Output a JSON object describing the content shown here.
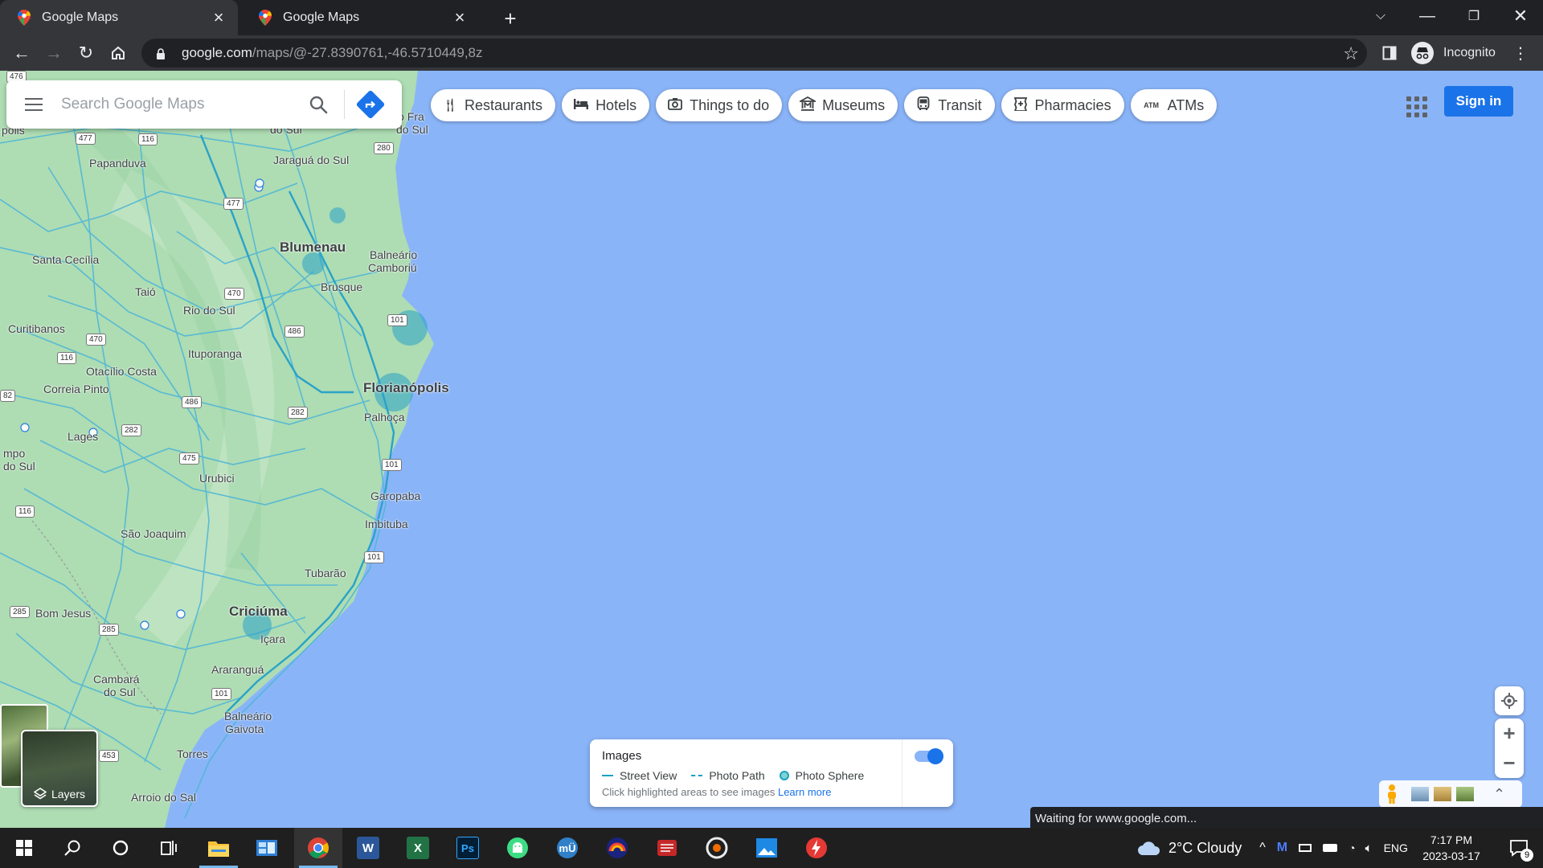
{
  "browser": {
    "tabs": [
      {
        "title": "Google Maps",
        "active": true
      },
      {
        "title": "Google Maps",
        "active": false
      }
    ],
    "new_tab_icon": "plus-icon",
    "url_host": "google.com",
    "url_path": "/maps/@-27.8390761,-46.5710449,8z",
    "profile_label": "Incognito"
  },
  "maps": {
    "search_placeholder": "Search Google Maps",
    "chips": [
      {
        "label": "Restaurants",
        "icon": "fork-knife-icon"
      },
      {
        "label": "Hotels",
        "icon": "bed-icon"
      },
      {
        "label": "Things to do",
        "icon": "camera-icon"
      },
      {
        "label": "Museums",
        "icon": "museum-icon"
      },
      {
        "label": "Transit",
        "icon": "bus-icon"
      },
      {
        "label": "Pharmacies",
        "icon": "pharmacy-icon"
      },
      {
        "label": "ATMs",
        "icon": "atm-icon"
      }
    ],
    "signin_label": "Sign in",
    "layers_label": "Layers",
    "images_panel": {
      "title": "Images",
      "legend": [
        "Street View",
        "Photo Path",
        "Photo Sphere"
      ],
      "hint": "Click highlighted areas to see images",
      "learn_more": "Learn more",
      "toggle_on": true
    },
    "zoom_in": "+",
    "zoom_out": "−",
    "status": "Waiting for www.google.com...",
    "atm_glyph": "ATM",
    "place_labels": {
      "blumenau": "Blumenau",
      "florianopolis": "Florianópolis",
      "criciuma": "Criciúma",
      "jaragua": "Jaraguá do Sul",
      "papanduva": "Papanduva",
      "santa_cecilia": "Santa Cecília",
      "taio": "Taió",
      "rio_do_sul": "Rio do Sul",
      "curitibanos": "Curitibanos",
      "ituporanga": "Ituporanga",
      "otacilio": "Otacílio Costa",
      "correia_pinto": "Correia Pinto",
      "lages": "Lages",
      "urubici": "Urubici",
      "sao_joaquim": "São Joaquim",
      "bom_jesus": "Bom Jesus",
      "cambara": "Cambará",
      "cambara2": "do Sul",
      "ararangua": "Araranguá",
      "balneario_gaivota": "Balneário",
      "balneario_gaivota2": "Gaivota",
      "torres": "Torres",
      "arroio": "Arroio do Sal",
      "brusque": "Brusque",
      "balneario_camboriu": "Balneário",
      "balneario_camboriu2": "Camboriú",
      "palhoca": "Palhoça",
      "garopaba": "Garopaba",
      "imbituba": "Imbituba",
      "tubarao": "Tubarão",
      "icara": "Içara",
      "sao_fra": "São Fra",
      "do_sul_top": "do Sul",
      "do_sul_left": "do Sul",
      "do_sul_left2": "do Sul",
      "campo": "mpo",
      "polis": "polis"
    },
    "shields": [
      "477",
      "116",
      "280",
      "477",
      "470",
      "101",
      "486",
      "470",
      "116",
      "486",
      "282",
      "282",
      "101",
      "475",
      "116",
      "101",
      "285",
      "285",
      "101",
      "453",
      "82",
      "476"
    ]
  },
  "taskbar": {
    "weather": "2°C  Cloudy",
    "lang": "ENG",
    "time": "7:17 PM",
    "date": "2023-03-17",
    "notifications": "9",
    "apps": [
      "start-icon",
      "search-icon",
      "cortana-icon",
      "task-view-icon",
      "file-explorer-icon",
      "control-panel-icon",
      "chrome-icon",
      "word-icon",
      "excel-icon",
      "photoshop-icon",
      "android-icon",
      "app-mu-icon",
      "app-rainbow-icon",
      "app-red-icon",
      "app-disc-icon",
      "photos-icon",
      "app-flash-icon"
    ]
  }
}
